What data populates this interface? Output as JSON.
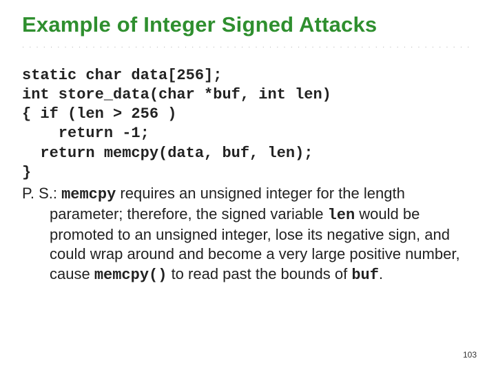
{
  "title": "Example of Integer Signed Attacks",
  "dot_row": "..................................................................................",
  "code": {
    "line1": "static char data[256];",
    "line2": "int store_data(char *buf, int len)",
    "line3": "{ if (len > 256 )",
    "line4": "    return -1;",
    "line5": "  return memcpy(data, buf, len);",
    "line6": "}"
  },
  "ps": {
    "label": "P. S.: ",
    "mono1": "memcpy",
    "seg1": " requires an unsigned integer for the length parameter; therefore, the signed variable ",
    "mono2": "len",
    "seg2": " would be promoted to an unsigned integer, lose its negative sign, and could wrap around and become a very large positive number, cause ",
    "mono3": "memcpy()",
    "seg3": " to read past the bounds of ",
    "mono4": "buf",
    "seg4": "."
  },
  "page_number": "103"
}
